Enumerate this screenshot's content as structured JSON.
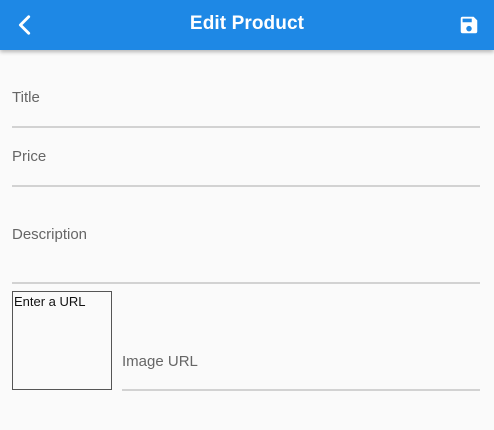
{
  "app_bar": {
    "title": "Edit Product",
    "back_icon": "chevron-left-icon",
    "save_icon": "floppy-disk-icon",
    "color": "#1e88e5"
  },
  "form": {
    "title_field": {
      "label": "Title",
      "value": ""
    },
    "price_field": {
      "label": "Price",
      "value": ""
    },
    "description_field": {
      "label": "Description",
      "value": ""
    },
    "image_preview": {
      "placeholder": "Enter a URL"
    },
    "image_url_field": {
      "label": "Image URL",
      "value": ""
    }
  }
}
